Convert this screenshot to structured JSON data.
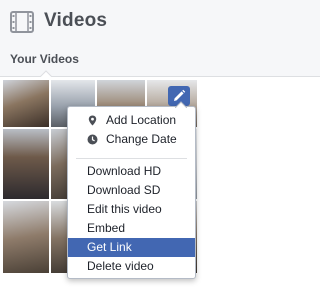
{
  "header": {
    "title": "Videos",
    "icon": "film-strip-icon"
  },
  "tabs": [
    {
      "label": "Your Videos"
    }
  ],
  "colors": {
    "accent": "#4267b2",
    "menu_highlight": "#4267b2"
  },
  "menu": {
    "items": [
      {
        "label": "Add Location",
        "icon": "location-pin-icon"
      },
      {
        "label": "Change Date",
        "icon": "clock-icon"
      },
      {
        "label": "Download HD"
      },
      {
        "label": "Download SD"
      },
      {
        "label": "Edit this video"
      },
      {
        "label": "Embed"
      },
      {
        "label": "Get Link",
        "highlighted": true
      },
      {
        "label": "Delete video"
      }
    ]
  }
}
